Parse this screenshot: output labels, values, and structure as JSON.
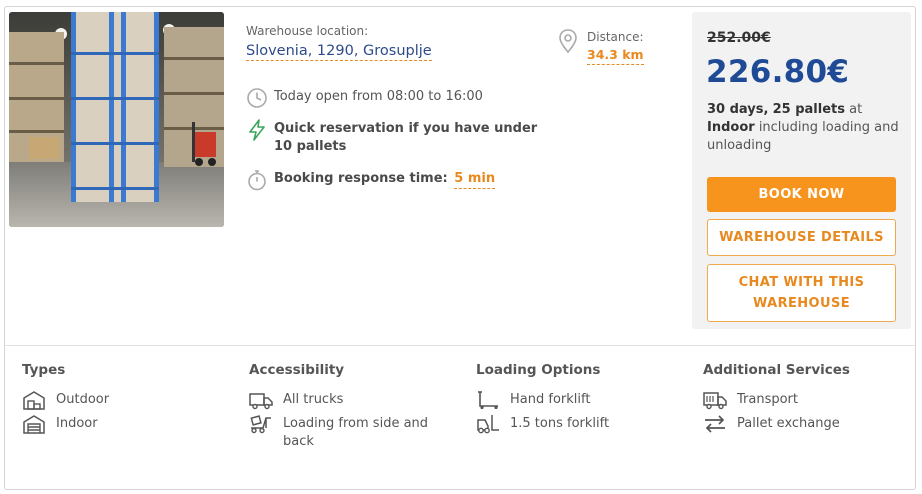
{
  "location": {
    "label": "Warehouse location:",
    "value": "Slovenia, 1290, Grosuplje"
  },
  "distance": {
    "label": "Distance:",
    "value": "34.3 km",
    "icon": "map-pin-icon"
  },
  "info": {
    "hours": "Today open from 08:00 to 16:00",
    "quick": "Quick reservation if you have under 10 pallets",
    "response_label": "Booking response time:",
    "response_value": "5 min"
  },
  "price": {
    "old": "252.00€",
    "new": "226.80€",
    "days": "30 days,",
    "pallets": "25 pallets",
    "at": "at",
    "storage": "Indoor",
    "including": "including loading and unloading"
  },
  "buttons": {
    "book": "BOOK NOW",
    "details": "WAREHOUSE DETAILS",
    "chat": "CHAT WITH THIS WAREHOUSE"
  },
  "features": {
    "types": {
      "title": "Types",
      "items": [
        {
          "label": "Outdoor",
          "icon": "outdoor-warehouse-icon"
        },
        {
          "label": "Indoor",
          "icon": "indoor-warehouse-icon"
        }
      ]
    },
    "accessibility": {
      "title": "Accessibility",
      "items": [
        {
          "label": "All trucks",
          "icon": "truck-icon"
        },
        {
          "label": "Loading from side and back",
          "icon": "loading-icon"
        }
      ]
    },
    "loading": {
      "title": "Loading Options",
      "items": [
        {
          "label": "Hand forklift",
          "icon": "hand-forklift-icon"
        },
        {
          "label": "1.5 tons forklift",
          "icon": "forklift-icon"
        }
      ]
    },
    "services": {
      "title": "Additional Services",
      "items": [
        {
          "label": "Transport",
          "icon": "transport-truck-icon"
        },
        {
          "label": "Pallet exchange",
          "icon": "exchange-arrows-icon"
        }
      ]
    }
  },
  "colors": {
    "accent_orange": "#f7941d",
    "price_blue": "#1f4a96",
    "link_blue": "#2d4b8c",
    "quick_green": "#3aa55b"
  }
}
